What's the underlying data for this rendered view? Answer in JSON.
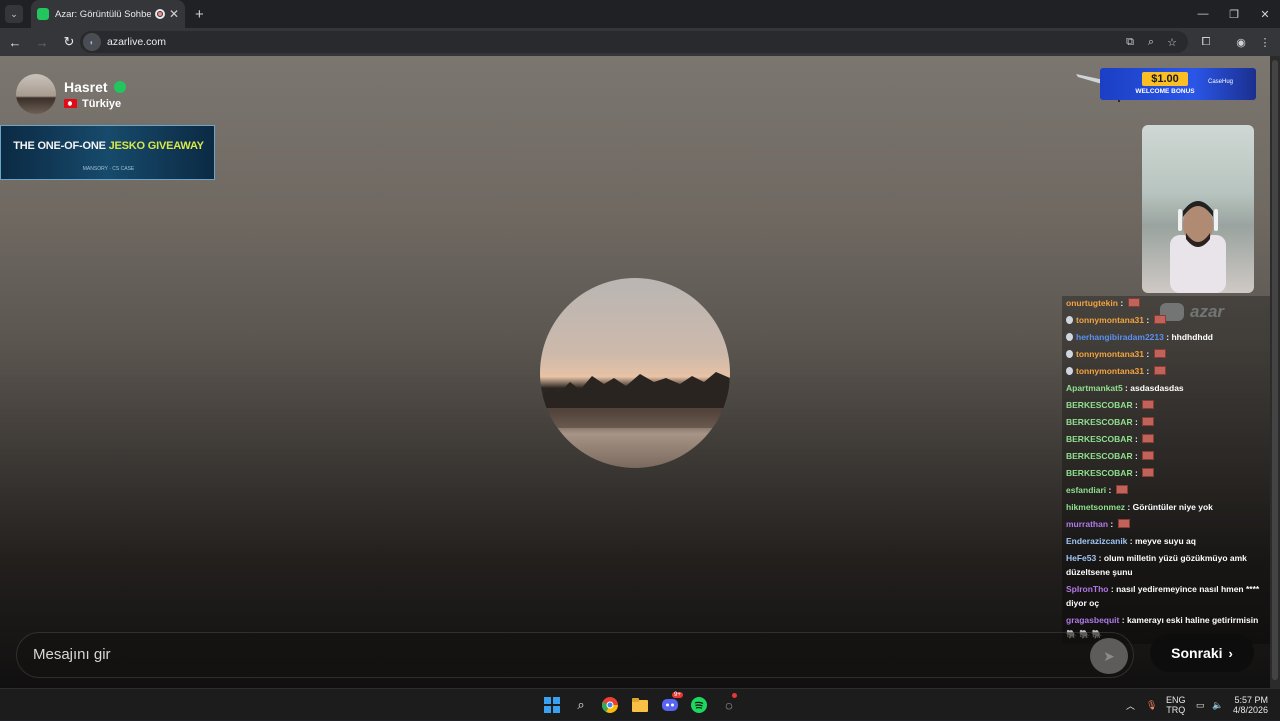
{
  "browser": {
    "tab_title": "Azar: Görüntülü Sohbet & V",
    "url": "azarlive.com"
  },
  "profile": {
    "name": "Hasret",
    "country": "Türkiye"
  },
  "ads": {
    "left_title_a": "THE ONE-OF-ONE",
    "left_title_b": "JESKO GIVEAWAY",
    "left_sub": "MANSORY  ·  CS CASE",
    "right_price": "$1.00",
    "right_bonus": "WELCOME BONUS",
    "right_brand": "CaseHug"
  },
  "brand": {
    "logo_text": "azar"
  },
  "chat": {
    "messages": [
      {
        "user": "onurtugtekin",
        "text": "",
        "color": "orange",
        "badge": false,
        "emote": true
      },
      {
        "user": "tonnymontana31",
        "text": "",
        "color": "orange",
        "badge": true,
        "emote": true
      },
      {
        "user": "herhangibiradam2213",
        "text": "hhdhdhdd",
        "color": "blue",
        "badge": true,
        "emote": false
      },
      {
        "user": "tonnymontana31",
        "text": "",
        "color": "orange",
        "badge": true,
        "emote": true
      },
      {
        "user": "tonnymontana31",
        "text": "",
        "color": "orange",
        "badge": true,
        "emote": true
      },
      {
        "user": "Apartmankat5",
        "text": "asdasdasdas",
        "color": "green",
        "badge": false,
        "emote": false
      },
      {
        "user": "BERKESCOBAR",
        "text": "",
        "color": "green",
        "badge": false,
        "emote": true
      },
      {
        "user": "BERKESCOBAR",
        "text": "",
        "color": "green",
        "badge": false,
        "emote": true
      },
      {
        "user": "BERKESCOBAR",
        "text": "",
        "color": "green",
        "badge": false,
        "emote": true
      },
      {
        "user": "BERKESCOBAR",
        "text": "",
        "color": "green",
        "badge": false,
        "emote": true
      },
      {
        "user": "BERKESCOBAR",
        "text": "",
        "color": "green",
        "badge": false,
        "emote": true
      },
      {
        "user": "esfandiari",
        "text": "",
        "color": "green",
        "badge": false,
        "emote": true
      },
      {
        "user": "hikmetsonmez",
        "text": "Görüntüler niye yok",
        "color": "green",
        "badge": false,
        "emote": false
      },
      {
        "user": "murrathan",
        "text": "",
        "color": "purple",
        "badge": false,
        "emote": true
      },
      {
        "user": "Enderazizcanik",
        "text": "meyve suyu aq",
        "color": "lightblue",
        "badge": false,
        "emote": false
      },
      {
        "user": "HeFe53",
        "text": "olum milletin yüzü gözükmüyo amk düzeltsene şunu",
        "color": "lightblue",
        "badge": false,
        "emote": false
      },
      {
        "user": "SpIronTho",
        "text": "nasıl yediremeyince nasıl hmen **** diyor oç",
        "color": "purple",
        "badge": false,
        "emote": false
      },
      {
        "user": "gragasbequit",
        "text": "kamerayı eski haline getirirmisin 🐘 🐘 🐘",
        "color": "purple",
        "badge": false,
        "emote": false
      }
    ]
  },
  "input": {
    "placeholder": "Mesajını gir"
  },
  "next_button": {
    "label": "Sonraki"
  },
  "taskbar": {
    "language_top": "ENG",
    "language_bottom": "TRQ",
    "time": "5:57 PM",
    "date": "4/8/2026",
    "discord_badge": "9+"
  }
}
